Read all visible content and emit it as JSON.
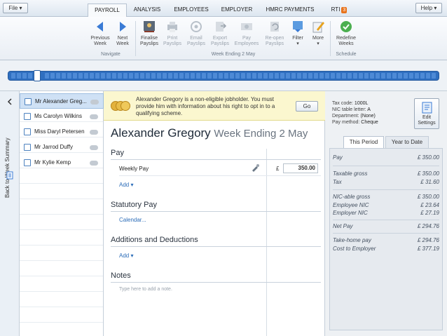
{
  "menu": {
    "file": "File ▾",
    "help": "Help ▾"
  },
  "tabs": [
    {
      "label": "PAYROLL"
    },
    {
      "label": "ANALYSIS"
    },
    {
      "label": "EMPLOYEES"
    },
    {
      "label": "EMPLOYER"
    },
    {
      "label": "HMRC PAYMENTS"
    },
    {
      "label": "RTI",
      "badge": "3"
    }
  ],
  "ribbon": {
    "prev": [
      "Previous",
      "Week"
    ],
    "next": [
      "Next",
      "Week"
    ],
    "finalise": [
      "Finalise",
      "Payslips"
    ],
    "print": [
      "Print",
      "Payslips"
    ],
    "email": [
      "Email",
      "Payslips"
    ],
    "export": [
      "Export",
      "Payslips"
    ],
    "pay": [
      "Pay",
      "Employees"
    ],
    "reopen": [
      "Re-open",
      "Payslips"
    ],
    "filter": [
      "Filter",
      "▾"
    ],
    "more": [
      "More",
      "▾"
    ],
    "redefine": [
      "Redefine",
      "Weeks"
    ],
    "group_navigate": "Navigate",
    "group_week": "Week Ending 2 May",
    "group_schedule": "Schedule"
  },
  "sidebar": {
    "back_label": "Back to Week Summary"
  },
  "employees": [
    {
      "name": "Mr Alexander Greg..."
    },
    {
      "name": "Ms Carolyn Wilkins"
    },
    {
      "name": "Miss Daryl Petersen"
    },
    {
      "name": "Mr Jarrod Duffy"
    },
    {
      "name": "Mr Kylie Kemp"
    }
  ],
  "notice": {
    "text": "Alexander Gregory is a non-eligible jobholder. You must provide him with information about his right to opt in to a qualifying scheme.",
    "go": "Go"
  },
  "main": {
    "name": "Alexander Gregory",
    "period": "Week Ending 2 May",
    "pay": {
      "heading": "Pay",
      "row_label": "Weekly Pay",
      "currency": "£",
      "amount": "350.00",
      "add": "Add ▾"
    },
    "statutory": {
      "heading": "Statutory Pay",
      "link": "Calendar..."
    },
    "additions": {
      "heading": "Additions and Deductions",
      "add": "Add ▾"
    },
    "notes": {
      "heading": "Notes",
      "placeholder": "Type here to add a note."
    }
  },
  "summary": {
    "tax_code_label": "Tax code:",
    "tax_code": "1000L",
    "nic_label": "NIC table letter:",
    "nic": "A",
    "dept_label": "Department:",
    "dept": "(None)",
    "method_label": "Pay method:",
    "method": "Cheque",
    "edit": [
      "Edit",
      "Settings"
    ],
    "tab_period": "This Period",
    "tab_ytd": "Year to Date",
    "rows": [
      {
        "label": "Pay",
        "value": "£ 350.00"
      },
      {
        "label": "Taxable gross",
        "value": "£ 350.00"
      },
      {
        "label": "Tax",
        "value": "£ 31.60"
      },
      {
        "label": "NIC-able gross",
        "value": "£ 350.00"
      },
      {
        "label": "Employee NIC",
        "value": "£ 23.64"
      },
      {
        "label": "Employer NIC",
        "value": "£ 27.19"
      },
      {
        "label": "Net Pay",
        "value": "£ 294.76"
      },
      {
        "label": "Take-home pay",
        "value": "£ 294.76"
      },
      {
        "label": "Cost to Employer",
        "value": "£ 377.19"
      }
    ]
  },
  "colors": {
    "accent": "#2f6fc0",
    "notice_bg": "#fbf7cf",
    "badge": "#e8731c"
  }
}
